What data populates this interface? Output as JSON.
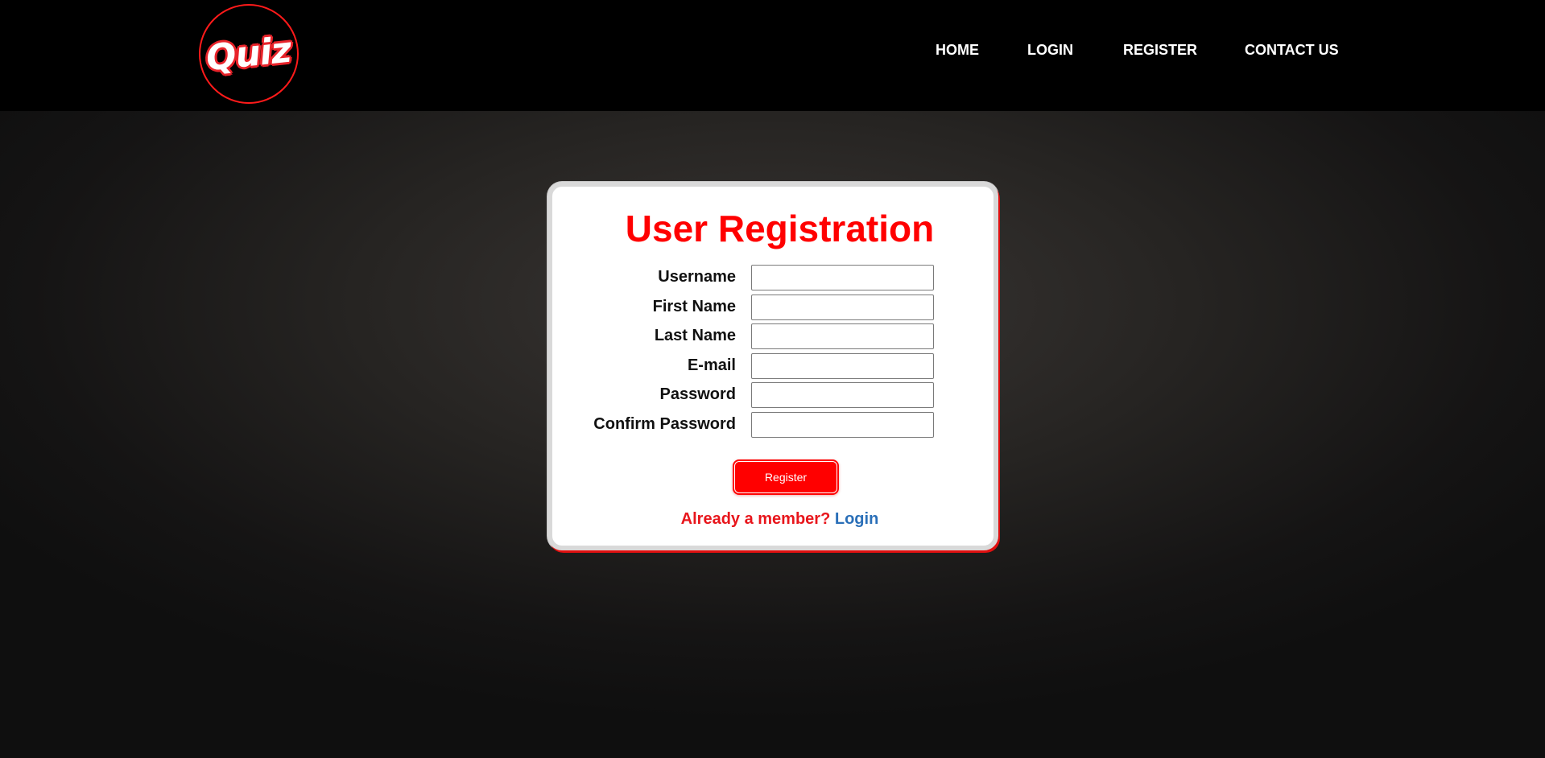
{
  "header": {
    "logo_text": "Quiz",
    "nav": [
      {
        "label": "HOME"
      },
      {
        "label": "LOGIN"
      },
      {
        "label": "REGISTER"
      },
      {
        "label": "CONTACT US"
      }
    ]
  },
  "form": {
    "title": "User Registration",
    "fields": [
      {
        "label": "Username",
        "value": ""
      },
      {
        "label": "First Name",
        "value": ""
      },
      {
        "label": "Last Name",
        "value": ""
      },
      {
        "label": "E-mail",
        "value": ""
      },
      {
        "label": "Password",
        "value": ""
      },
      {
        "label": "Confirm Password",
        "value": ""
      }
    ],
    "submit_label": "Register",
    "member_prompt": "Already a member?",
    "login_link": "Login"
  },
  "colors": {
    "accent": "#ff0000",
    "link": "#2a6fb8",
    "header_bg": "#000000"
  }
}
